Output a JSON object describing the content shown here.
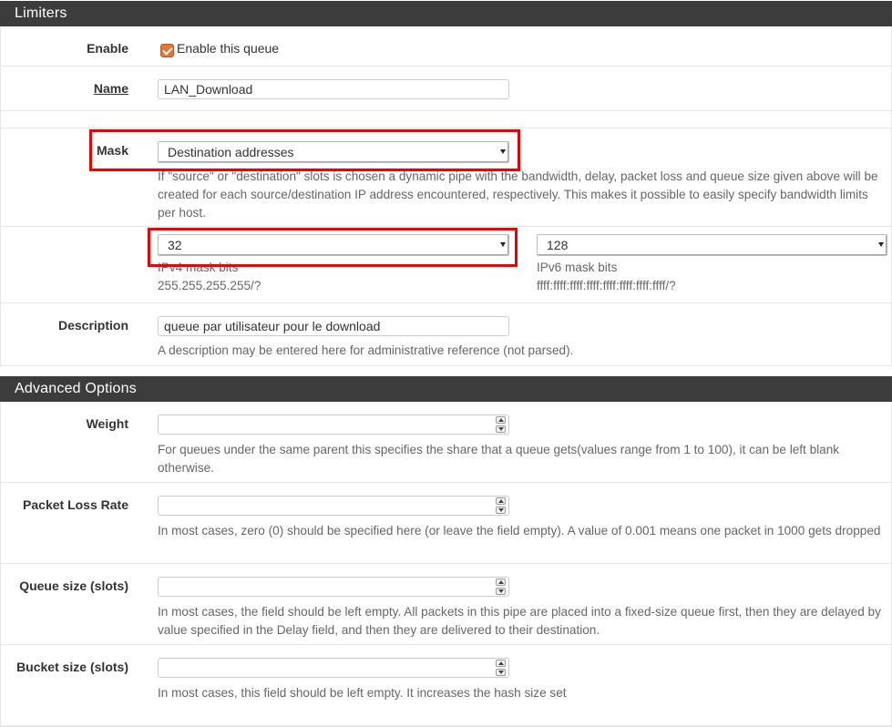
{
  "limiters": {
    "heading": "Limiters",
    "enable": {
      "label": "Enable",
      "checkbox_label": "Enable this queue",
      "checked": true
    },
    "name": {
      "label": "Name",
      "value": "LAN_Download"
    },
    "mask": {
      "label": "Mask",
      "selected": "Destination addresses",
      "help": "If \"source\" or \"destination\" slots is chosen a dynamic pipe with the bandwidth, delay, packet loss and queue size given above will be created for each source/destination IP address encountered, respectively. This makes it possible to easily specify bandwidth limits per host."
    },
    "ipv4": {
      "selected": "32",
      "label": "IPv4 mask bits",
      "hint": "255.255.255.255/?"
    },
    "ipv6": {
      "selected": "128",
      "label": "IPv6 mask bits",
      "hint": "ffff:ffff:ffff:ffff:ffff:ffff:ffff:ffff/?"
    },
    "description": {
      "label": "Description",
      "value": "queue par utilisateur pour le download",
      "help": "A description may be entered here for administrative reference (not parsed)."
    }
  },
  "advanced": {
    "heading": "Advanced Options",
    "weight": {
      "label": "Weight",
      "value": "",
      "help": "For queues under the same parent this specifies the share that a queue gets(values range from 1 to 100), it can be left blank otherwise."
    },
    "packet_loss": {
      "label": "Packet Loss Rate",
      "value": "",
      "help": "In most cases, zero (0) should be specified here (or leave the field empty). A value of 0.001 means one packet in 1000 gets dropped"
    },
    "queue_size": {
      "label": "Queue size (slots)",
      "value": "",
      "help": "In most cases, the field should be left empty. All packets in this pipe are placed into a fixed-size queue first, then they are delayed by value specified in the Delay field, and then they are delivered to their destination."
    },
    "bucket_size": {
      "label": "Bucket size (slots)",
      "value": "",
      "help": "In most cases, this field should be left empty. It increases the hash size set"
    }
  },
  "colors": {
    "heading_bg": "#3c3c3c",
    "accent": "#e0763c",
    "highlight": "#e00000"
  }
}
